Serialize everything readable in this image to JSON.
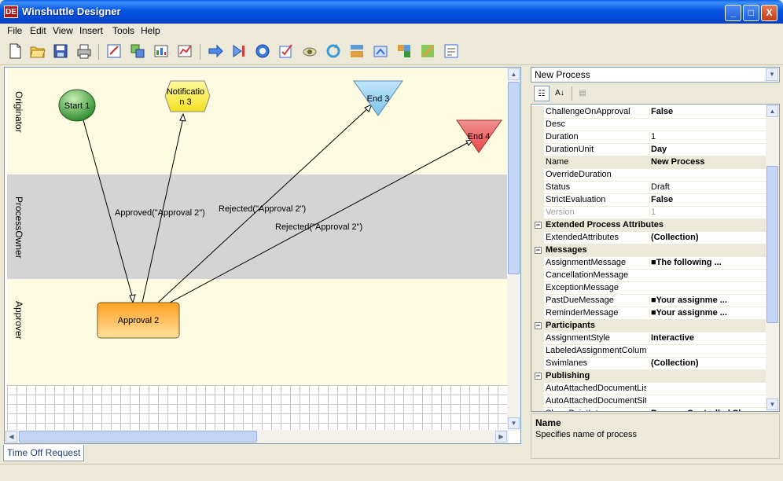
{
  "window": {
    "title": "Winshuttle Designer",
    "app_icon": "DE",
    "minimize": "_",
    "maximize": "□",
    "close": "X"
  },
  "menu": [
    "File",
    "Edit",
    "View",
    "Insert",
    "Tools",
    "Help"
  ],
  "toolbar": {
    "icons": [
      "new-icon",
      "open-icon",
      "save-icon",
      "print-icon",
      "form-icon",
      "add-form-icon",
      "data-icon",
      "chart-icon",
      "arrow-right-icon",
      "step-end-icon",
      "circle-icon",
      "checklist-icon",
      "eye-icon",
      "refresh-icon",
      "export-icon",
      "import-icon",
      "gear-icon",
      "edit-icon",
      "validate-icon"
    ]
  },
  "diagram": {
    "lanes": [
      {
        "label": "Originator",
        "color": "#fdfbe1"
      },
      {
        "label": "ProcessOwner",
        "color": "#d4d4d4"
      },
      {
        "label": "Approver",
        "color": "#fdfbe1"
      }
    ],
    "nodes": {
      "start": "Start 1",
      "notification_l1": "Notificatio",
      "notification_l2": "n 3",
      "end3": "End 3",
      "end4": "End 4",
      "approval": "Approval 2"
    },
    "edges": {
      "approved": "Approved(\"Approval 2\")",
      "rejected1": "Rejected(\"Approval 2\")",
      "rejected2": "Rejected(\"Approval 2\")"
    }
  },
  "tabs": {
    "active": "Time Off Request"
  },
  "property_grid": {
    "object": "New Process",
    "rows": [
      {
        "kind": "prop",
        "name": "ChallengeOnApproval",
        "value": "False",
        "style": "bold"
      },
      {
        "kind": "prop",
        "name": "Desc",
        "value": "",
        "style": ""
      },
      {
        "kind": "prop",
        "name": "Duration",
        "value": "1",
        "style": ""
      },
      {
        "kind": "prop",
        "name": "DurationUnit",
        "value": "Day",
        "style": "bold"
      },
      {
        "kind": "prop",
        "name": "Name",
        "value": "New Process",
        "style": "bold"
      },
      {
        "kind": "prop",
        "name": "OverrideDuration",
        "value": "",
        "style": ""
      },
      {
        "kind": "prop",
        "name": "Status",
        "value": "Draft",
        "style": ""
      },
      {
        "kind": "prop",
        "name": "StrictEvaluation",
        "value": "False",
        "style": "bold"
      },
      {
        "kind": "prop",
        "name": "Version",
        "value": "1",
        "style": "grey"
      },
      {
        "kind": "cat",
        "name": "Extended Process Attributes",
        "toggle": "−"
      },
      {
        "kind": "prop",
        "name": "ExtendedAttributes",
        "value": "(Collection)",
        "style": "bold"
      },
      {
        "kind": "cat",
        "name": "Messages",
        "toggle": "−"
      },
      {
        "kind": "prop",
        "name": "AssignmentMessage",
        "value": "■The following ...",
        "style": "bold"
      },
      {
        "kind": "prop",
        "name": "CancellationMessage",
        "value": "",
        "style": ""
      },
      {
        "kind": "prop",
        "name": "ExceptionMessage",
        "value": "",
        "style": ""
      },
      {
        "kind": "prop",
        "name": "PastDueMessage",
        "value": "■Your assignme ...",
        "style": "bold"
      },
      {
        "kind": "prop",
        "name": "ReminderMessage",
        "value": "■Your assignme ...",
        "style": "bold"
      },
      {
        "kind": "cat",
        "name": "Participants",
        "toggle": "−"
      },
      {
        "kind": "prop",
        "name": "AssignmentStyle",
        "value": "Interactive",
        "style": "bold"
      },
      {
        "kind": "prop",
        "name": "LabeledAssignmentColumr",
        "value": "",
        "style": ""
      },
      {
        "kind": "prop",
        "name": "Swimlanes",
        "value": "(Collection)",
        "style": "bold"
      },
      {
        "kind": "cat",
        "name": "Publishing",
        "toggle": "−"
      },
      {
        "kind": "prop",
        "name": "AutoAttachedDocumentLis",
        "value": "",
        "style": ""
      },
      {
        "kind": "prop",
        "name": "AutoAttachedDocumentSit",
        "value": "",
        "style": ""
      },
      {
        "kind": "prop",
        "name": "SharePointIntegr",
        "value": "Process Controlled Sl",
        "style": "bold"
      }
    ]
  },
  "description": {
    "title": "Name",
    "text": "Specifies name of process"
  }
}
